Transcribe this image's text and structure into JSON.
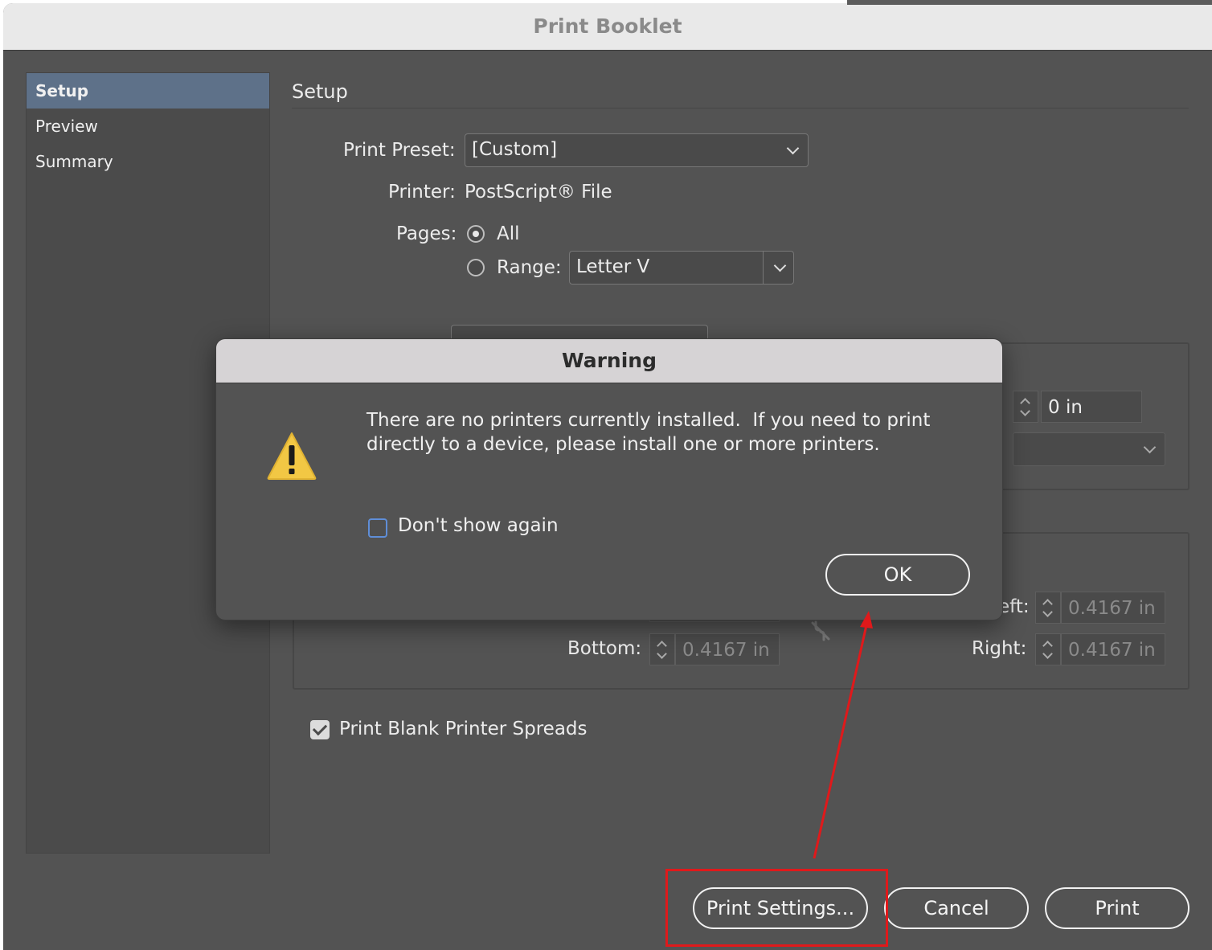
{
  "window": {
    "title": "Print Booklet"
  },
  "sidebar": {
    "items": [
      {
        "label": "Setup"
      },
      {
        "label": "Preview"
      },
      {
        "label": "Summary"
      }
    ]
  },
  "setup": {
    "section_title": "Setup",
    "print_preset_label": "Print Preset:",
    "print_preset_value": "[Custom]",
    "printer_label": "Printer:",
    "printer_value": "PostScript® File",
    "pages_label": "Pages:",
    "pages_all": "All",
    "pages_range": "Range:",
    "range_value": "Letter V",
    "creep_value": "0 in",
    "margins": {
      "left_label": "eft:",
      "left_value": "0.4167 in",
      "bottom_label": "Bottom:",
      "bottom_value": "0.4167 in",
      "right_label": "Right:",
      "right_value": "0.4167 in"
    },
    "print_blank_spreads": "Print Blank Printer Spreads"
  },
  "buttons": {
    "print_settings": "Print Settings...",
    "cancel": "Cancel",
    "print": "Print"
  },
  "warning": {
    "title": "Warning",
    "line1": "There are no printers currently installed.  If you need to print",
    "line2": "directly to a device, please install one or more printers.",
    "dont_show": "Don't show again",
    "ok": "OK"
  },
  "colors": {
    "window_bg": "#535353",
    "selection": "#5e7189",
    "annotation": "#e0191b",
    "warning_icon": "#f2c744"
  }
}
